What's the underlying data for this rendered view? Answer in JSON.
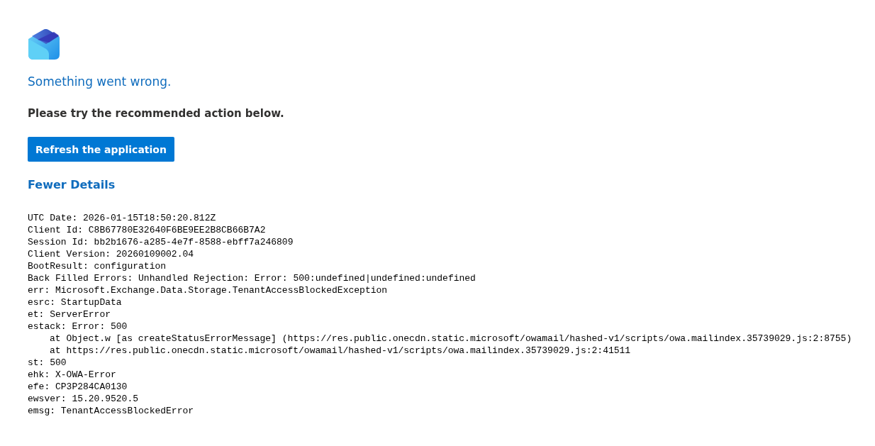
{
  "heading": "Something went wrong.",
  "instruction": "Please try the recommended action below.",
  "action_button": "Refresh the application",
  "details_link": {
    "label": "Fewer Details"
  },
  "details": [
    {
      "text": "UTC Date: 2026-01-15T18:50:20.812Z"
    },
    {
      "text": "Client Id: C8B67780E32640F6BE9EE2B8CB66B7A2"
    },
    {
      "text": "Session Id: bb2b1676-a285-4e7f-8588-ebff7a246809"
    },
    {
      "text": "Client Version: 20260109002.04"
    },
    {
      "text": "BootResult: configuration"
    },
    {
      "text": "Back Filled Errors: Unhandled Rejection: Error: 500:undefined|undefined:undefined"
    },
    {
      "text": "err: Microsoft.Exchange.Data.Storage.TenantAccessBlockedException"
    },
    {
      "text": "esrc: StartupData"
    },
    {
      "text": "et: ServerError"
    },
    {
      "text": "estack: Error: 500",
      "children": [
        {
          "text": "at Object.w [as createStatusErrorMessage] (https://res.public.onecdn.static.microsoft/owamail/hashed-v1/scripts/owa.mailindex.35739029.js:2:8755)"
        },
        {
          "text": "at https://res.public.onecdn.static.microsoft/owamail/hashed-v1/scripts/owa.mailindex.35739029.js:2:41511"
        }
      ]
    },
    {
      "text": "st: 500"
    },
    {
      "text": "ehk: X-OWA-Error"
    },
    {
      "text": "efe: CP3P284CA0130"
    },
    {
      "text": "ewsver: 15.20.9520.5"
    },
    {
      "text": "emsg: TenantAccessBlockedError"
    }
  ]
}
